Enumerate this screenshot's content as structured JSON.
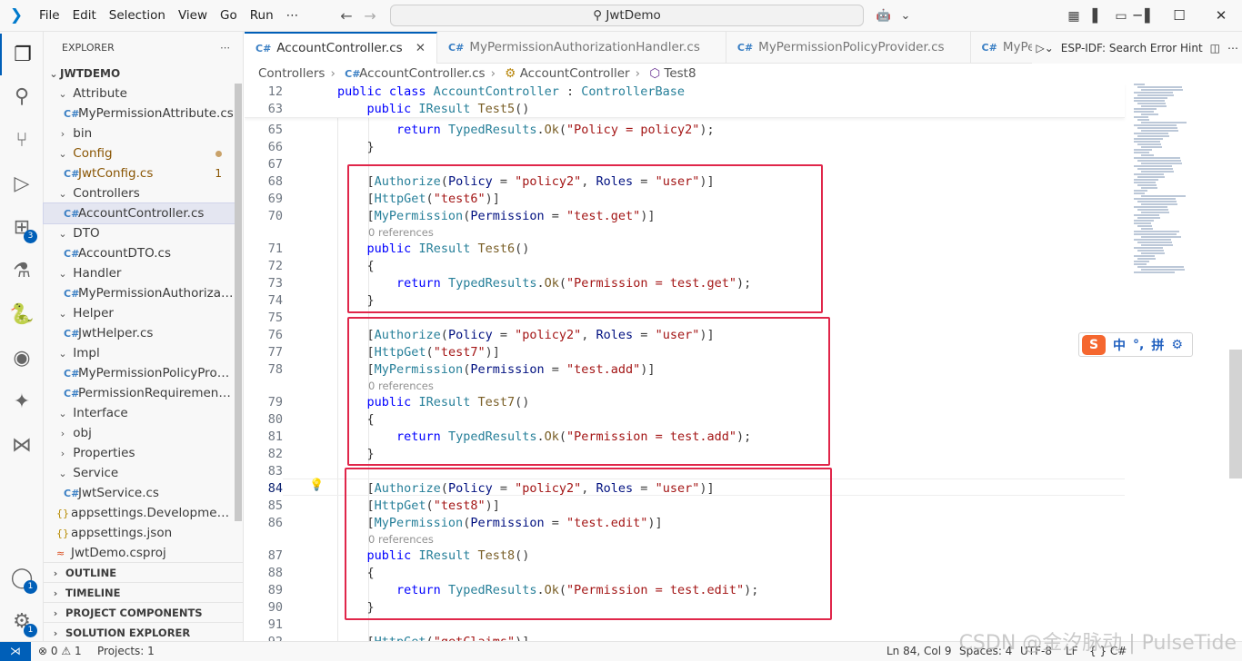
{
  "titlebar": {
    "menu": [
      "File",
      "Edit",
      "Selection",
      "View",
      "Go",
      "Run",
      "⋯"
    ],
    "search": "JwtDemo"
  },
  "activity": {
    "extensions_badge": "3",
    "accounts_badge": "1",
    "manage_badge": "1"
  },
  "explorer": {
    "title": "EXPLORER",
    "root": "JWTDEMO",
    "items": [
      {
        "label": "Attribute"
      },
      {
        "label": "MyPermissionAttribute.cs"
      },
      {
        "label": "bin"
      },
      {
        "label": "Config"
      },
      {
        "label": "JwtConfig.cs",
        "problems": "1"
      },
      {
        "label": "Controllers"
      },
      {
        "label": "AccountController.cs"
      },
      {
        "label": "DTO"
      },
      {
        "label": "AccountDTO.cs"
      },
      {
        "label": "Handler"
      },
      {
        "label": "MyPermissionAuthorizatio⋯"
      },
      {
        "label": "Helper"
      },
      {
        "label": "JwtHelper.cs"
      },
      {
        "label": "Impl"
      },
      {
        "label": "MyPermissionPolicyProvid⋯"
      },
      {
        "label": "PermissionRequirement.cs"
      },
      {
        "label": "Interface"
      },
      {
        "label": "obj"
      },
      {
        "label": "Properties"
      },
      {
        "label": "Service"
      },
      {
        "label": "JwtService.cs"
      },
      {
        "label": "appsettings.Development.js⋯"
      },
      {
        "label": "appsettings.json"
      },
      {
        "label": "JwtDemo.csproj"
      }
    ],
    "sections": [
      "OUTLINE",
      "TIMELINE",
      "PROJECT COMPONENTS",
      "SOLUTION EXPLORER"
    ]
  },
  "tabs": [
    {
      "label": "AccountController.cs"
    },
    {
      "label": "MyPermissionAuthorizationHandler.cs"
    },
    {
      "label": "MyPermissionPolicyProvider.cs"
    },
    {
      "label": "MyPermissionA"
    }
  ],
  "tab_tools": {
    "esp": "ESP-IDF: Search Error Hint"
  },
  "breadcrumb": [
    "Controllers",
    "AccountController.cs",
    "AccountController",
    "Test8"
  ],
  "editor": {
    "sticky": [
      {
        "num": "12",
        "text": "public class AccountController : ControllerBase"
      },
      {
        "num": "63",
        "text": "    public IResult Test5()"
      }
    ],
    "lines": [
      {
        "num": "65",
        "text": "        return TypedResults.Ok(\"Policy = policy2\");"
      },
      {
        "num": "66",
        "text": "    }"
      },
      {
        "num": "67",
        "text": ""
      },
      {
        "num": "68",
        "text": "    [Authorize(Policy = \"policy2\", Roles = \"user\")]"
      },
      {
        "num": "69",
        "text": "    [HttpGet(\"test6\")]"
      },
      {
        "num": "70",
        "text": "    [MyPermission(Permission = \"test.get\")]"
      },
      {
        "num": "71",
        "text": "    public IResult Test6()"
      },
      {
        "num": "72",
        "text": "    {"
      },
      {
        "num": "73",
        "text": "        return TypedResults.Ok(\"Permission = test.get\");"
      },
      {
        "num": "74",
        "text": "    }"
      },
      {
        "num": "75",
        "text": ""
      },
      {
        "num": "76",
        "text": "    [Authorize(Policy = \"policy2\", Roles = \"user\")]"
      },
      {
        "num": "77",
        "text": "    [HttpGet(\"test7\")]"
      },
      {
        "num": "78",
        "text": "    [MyPermission(Permission = \"test.add\")]"
      },
      {
        "num": "79",
        "text": "    public IResult Test7()"
      },
      {
        "num": "80",
        "text": "    {"
      },
      {
        "num": "81",
        "text": "        return TypedResults.Ok(\"Permission = test.add\");"
      },
      {
        "num": "82",
        "text": "    }"
      },
      {
        "num": "83",
        "text": ""
      },
      {
        "num": "84",
        "text": "    [Authorize(Policy = \"policy2\", Roles = \"user\")]"
      },
      {
        "num": "85",
        "text": "    [HttpGet(\"test8\")]"
      },
      {
        "num": "86",
        "text": "    [MyPermission(Permission = \"test.edit\")]"
      },
      {
        "num": "87",
        "text": "    public IResult Test8()"
      },
      {
        "num": "88",
        "text": "    {"
      },
      {
        "num": "89",
        "text": "        return TypedResults.Ok(\"Permission = test.edit\");"
      },
      {
        "num": "90",
        "text": "    }"
      },
      {
        "num": "91",
        "text": ""
      },
      {
        "num": "92",
        "text": "    [HttpGet(\"getClaims\")]"
      }
    ],
    "references": "0 references"
  },
  "ime": {
    "chars": [
      "中",
      "°,",
      "拼"
    ]
  },
  "statusbar": {
    "problems": "0",
    "warnings": "1",
    "projects": "Projects: 1",
    "position": "Ln 84, Col 9",
    "spaces": "Spaces: 4",
    "encoding": "UTF-8",
    "eol": "LF",
    "language": "{ } C#"
  },
  "watermark": "CSDN @金汐脉动 | PulseTide",
  "colors": {
    "accent": "#005fb8",
    "highlight_box": "#e0264a",
    "keyword": "#0000ff",
    "type": "#267f99",
    "string": "#a31515"
  }
}
